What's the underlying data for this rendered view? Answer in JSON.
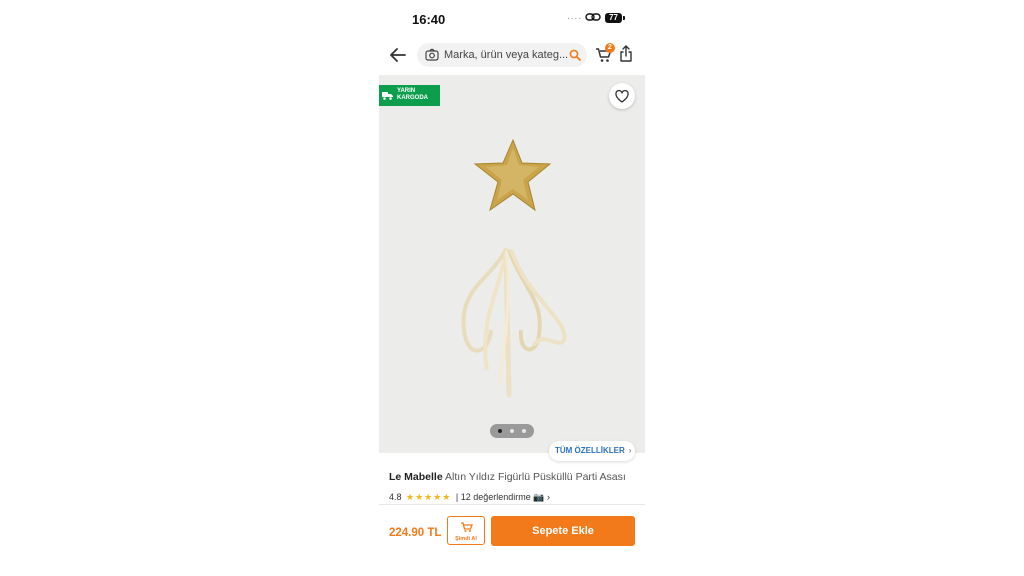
{
  "status_bar": {
    "time": "16:40",
    "signal": "....",
    "battery": "77"
  },
  "header": {
    "search_placeholder": "Marka, ürün veya kateg...",
    "cart_count": "2",
    "icons": [
      "arrow-left-icon",
      "camera-icon",
      "search-icon",
      "cart-icon",
      "share-icon"
    ]
  },
  "product_image": {
    "badge_line1": "YARIN",
    "badge_line2": "KARGODA",
    "all_specs": "TÜM ÖZELLİKLER",
    "pager_total": 3,
    "pager_active": 1
  },
  "product": {
    "brand": "Le Mabelle",
    "name": "Altın Yıldız Figürlü Püsküllü Parti Asası",
    "rating": "4.8",
    "stars": "★★★★★",
    "reviews": "| 12 değerlendirme"
  },
  "bottom_bar": {
    "price": "224.90 TL",
    "buy_now": "Şimdi Al",
    "add_to_cart": "Sepete Ekle"
  },
  "colors": {
    "accent": "#f27a1a",
    "badge_green": "#0d9e4d",
    "link_blue": "#2a72c1",
    "star": "#f8b51b"
  }
}
